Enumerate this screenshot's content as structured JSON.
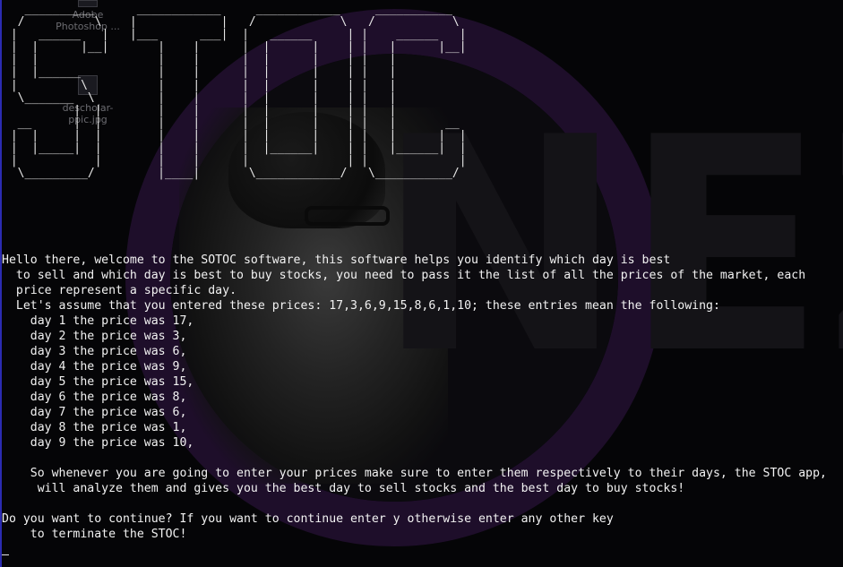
{
  "desktop_icons": [
    {
      "label_line1": "Adobe",
      "label_line2": "Photoshop ..."
    },
    {
      "label_line1": "descholar-",
      "label_line2": "ppic.jpg"
    }
  ],
  "wallpaper": {
    "watermark": "NEZ"
  },
  "banner_art": [
    "   __________      ____________     ____________     ___________",
    "  /          \\    |            |   /            \\   /           \\",
    " |   ______   |   |___      ___|  |   ______     | |    ______   |",
    " |  |      |__|       |    |      |  |      |    | |   |      |__|",
    " |  |                 |    |      |  |      |    | |   |",
    " |  |______           |    |      |  |      |    | |   |",
    " |         \\          |    |      |  |      |    | |   |",
    "  \\_______  \\         |    |      |  |      |    | |   |",
    "          |  |        |    |      |  |      |    | |   |",
    "  __      |  |        |    |      |  |      |    | |   |       __",
    " |  |     |  |        |    |      |  |      |    | |   |      |  |",
    " |  |_____|  |        |    |      |  |______|    | |   |______|  |",
    " |           |        |    |      |              | |             |",
    "  \\_________/         |____|       \\____________/   \\___________/"
  ],
  "terminal": {
    "lines": [
      "Hello there, welcome to the SOTOC software, this software helps you identify which day is best",
      "  to sell and which day is best to buy stocks, you need to pass it the list of all the prices of the market, each",
      "  price represent a specific day.",
      "  Let's assume that you entered these prices: 17,3,6,9,15,8,6,1,10; these entries mean the following:",
      "    day 1 the price was 17,",
      "    day 2 the price was 3,",
      "    day 3 the price was 6,",
      "    day 4 the price was 9,",
      "    day 5 the price was 15,",
      "    day 6 the price was 8,",
      "    day 7 the price was 6,",
      "    day 8 the price was 1,",
      "    day 9 the price was 10,",
      "",
      "    So whenever you are going to enter your prices make sure to enter them respectively to their days, the STOC app,",
      "     will analyze them and gives you the best day to sell stocks and the best day to buy stocks!",
      "",
      "Do you want to continue? If you want to continue enter y otherwise enter any other key",
      "    to terminate the STOC!"
    ]
  },
  "colors": {
    "background": "#050507",
    "text": "#f2f2f2",
    "ring": "#1e0e2a"
  }
}
